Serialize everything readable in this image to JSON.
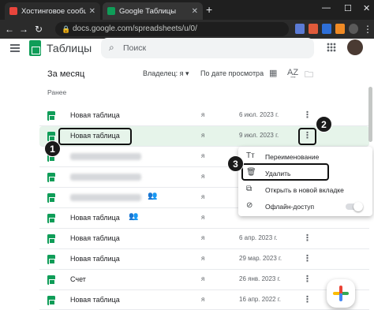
{
  "browser": {
    "tabs": [
      {
        "title": "Хостинговое сообщество «Tim",
        "icon": "hosting-favicon",
        "color": "#e8453c"
      },
      {
        "title": "Google Таблицы",
        "icon": "sheets-favicon",
        "color": "#0f9d58"
      }
    ],
    "url": "docs.google.com/spreadsheets/u/0/"
  },
  "header": {
    "app_title": "Таблицы",
    "search_placeholder": "Поиск"
  },
  "filters": {
    "heading": "За месяц",
    "owner": "Владелец: я",
    "sort": "По дате просмотра"
  },
  "section_label": "Ранее",
  "files": [
    {
      "name": "Новая таблица",
      "owner": "я",
      "date": "6 июл. 2023 г."
    },
    {
      "name": "Новая таблица",
      "owner": "я",
      "date": "9 июл. 2023 г."
    },
    {
      "name": "",
      "owner": "я",
      "date": ""
    },
    {
      "name": "",
      "owner": "я",
      "date": ""
    },
    {
      "name": "Новая таблица",
      "owner": "я",
      "date": ""
    },
    {
      "name": "Новая таблица",
      "owner": "я",
      "date": ""
    },
    {
      "name": "Новая таблица",
      "owner": "я",
      "date": "6 апр. 2023 г."
    },
    {
      "name": "Новая таблица",
      "owner": "я",
      "date": "29 мар. 2023 г."
    },
    {
      "name": "Счет",
      "owner": "я",
      "date": "26 янв. 2023 г."
    },
    {
      "name": "Новая таблица",
      "owner": "я",
      "date": "16 апр. 2022 г."
    }
  ],
  "context_menu": {
    "items": [
      {
        "label": "Переименование",
        "icon": "rename-icon"
      },
      {
        "label": "Удалить",
        "icon": "trash-icon"
      },
      {
        "label": "Открыть в новой вкладке",
        "icon": "open-new-tab-icon"
      },
      {
        "label": "Офлайн-доступ",
        "icon": "offline-icon"
      }
    ],
    "offline_enabled": false
  },
  "steps": [
    "1",
    "2",
    "3"
  ],
  "colors": {
    "accent": "#0f9d58",
    "selected_row": "#e6f4ea"
  }
}
